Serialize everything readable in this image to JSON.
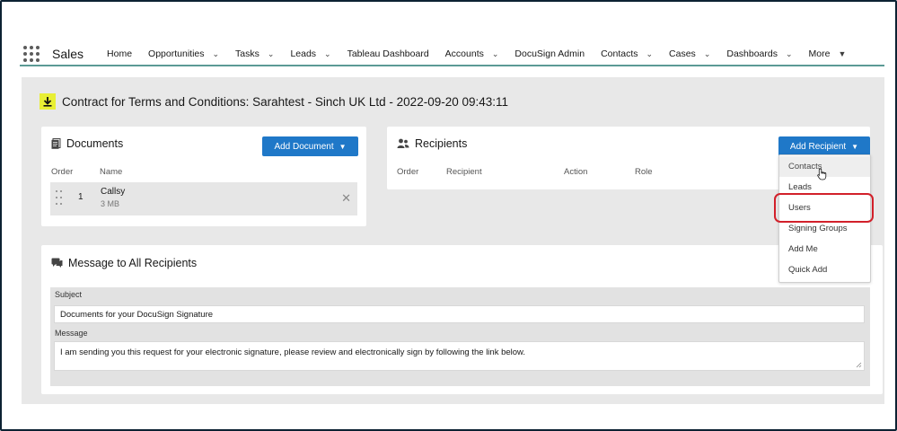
{
  "nav": {
    "app_name": "Sales",
    "items": [
      {
        "label": "Home",
        "chevron": false
      },
      {
        "label": "Opportunities",
        "chevron": true
      },
      {
        "label": "Tasks",
        "chevron": true
      },
      {
        "label": "Leads",
        "chevron": true
      },
      {
        "label": "Tableau Dashboard",
        "chevron": false
      },
      {
        "label": "Accounts",
        "chevron": true
      },
      {
        "label": "DocuSign Admin",
        "chevron": false
      },
      {
        "label": "Contacts",
        "chevron": true
      },
      {
        "label": "Cases",
        "chevron": true
      },
      {
        "label": "Dashboards",
        "chevron": true
      }
    ],
    "more_label": "More"
  },
  "page": {
    "title": "Contract for Terms and Conditions: Sarahtest - Sinch UK Ltd - 2022-09-20 09:43:11"
  },
  "documents": {
    "title": "Documents",
    "add_button": "Add Document",
    "columns": {
      "order": "Order",
      "name": "Name"
    },
    "rows": [
      {
        "order": "1",
        "name": "Callsy",
        "size": "3 MB"
      }
    ]
  },
  "recipients": {
    "title": "Recipients",
    "add_button": "Add Recipient",
    "columns": {
      "order": "Order",
      "recipient": "Recipient",
      "action": "Action",
      "role": "Role"
    },
    "menu": [
      "Contacts",
      "Leads",
      "Users",
      "Signing Groups",
      "Add Me",
      "Quick Add"
    ],
    "hovered_item": "Contacts",
    "highlighted_item": "Users"
  },
  "message": {
    "title": "Message to All Recipients",
    "subject_label": "Subject",
    "subject_value": "Documents for your DocuSign Signature",
    "message_label": "Message",
    "message_value": "I am sending you this request for your electronic signature, please review and electronically sign by following the link below."
  },
  "colors": {
    "accent_blue": "#1f78c8",
    "highlight_red": "#d2202a",
    "nav_underline": "#5b9a95",
    "download_icon_bg": "#e8ef34",
    "page_bg": "#e8e8e8"
  }
}
